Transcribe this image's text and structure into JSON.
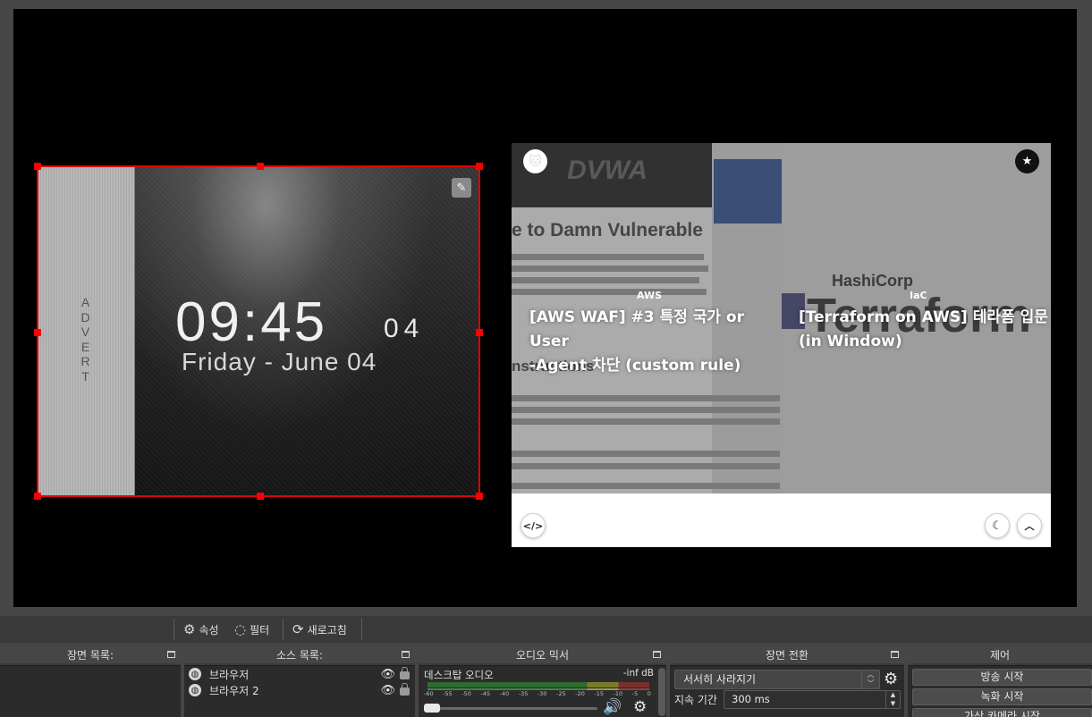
{
  "preview": {
    "clock": {
      "time": "09:45",
      "seconds": "04",
      "date": "Friday - June 04",
      "advert_letters": [
        "A",
        "D",
        "V",
        "E",
        "R",
        "T"
      ]
    },
    "blog": {
      "card1": {
        "tag": "AWS",
        "title_line1": "[AWS WAF] #3 특정 국가 or User",
        "title_line2": "-Agent 차단 (custom rule)",
        "bg_logo": "DVWA",
        "bg_heading": "e to Damn Vulnerable",
        "bg_sub": "nstructions"
      },
      "card2": {
        "tag": "IaC",
        "title_line1": "[Terraform on AWS] 테라폼 입문",
        "title_line2": "(in Window)",
        "bg_brand": "HashiCorp",
        "bg_product": "Terraform"
      }
    }
  },
  "toolbar": {
    "properties_label": "속성",
    "filters_label": "필터",
    "refresh_label": "새로고침"
  },
  "docks": {
    "scenes": {
      "title": "장면 목록:"
    },
    "sources": {
      "title": "소스 목록:",
      "items": [
        {
          "name": "브라우저"
        },
        {
          "name": "브라우저 2"
        }
      ]
    },
    "mixer": {
      "title": "오디오 믹서",
      "channel_name": "데스크탑 오디오",
      "level": "-inf dB",
      "ticks": [
        "-60",
        "-55",
        "-50",
        "-45",
        "-40",
        "-35",
        "-30",
        "-25",
        "-20",
        "-15",
        "-10",
        "-5",
        "0"
      ]
    },
    "transitions": {
      "title": "장면 전환",
      "selected": "서서히 사라지기",
      "duration_label": "지속 기간",
      "duration_value": "300 ms"
    },
    "controls": {
      "title": "제어",
      "start_streaming": "방송 시작",
      "start_recording": "녹화 시작",
      "virtual_camera": "가상 카메라 시작"
    }
  },
  "colors": {
    "selection": "#e00000",
    "panel_bg": "#3a3a3a",
    "list_bg": "#2b2b2b"
  }
}
